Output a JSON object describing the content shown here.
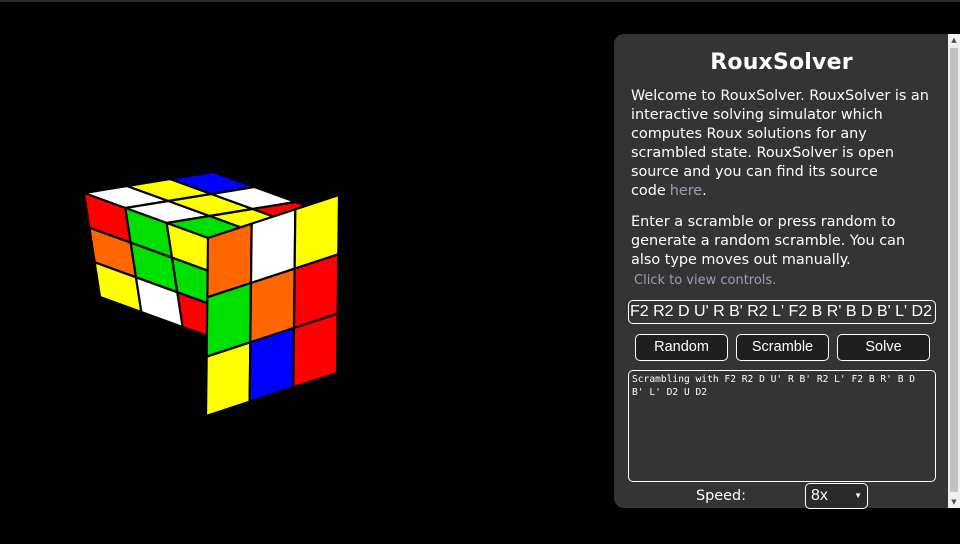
{
  "app": {
    "title": "RouxSolver"
  },
  "intro": {
    "text": "Welcome to RouxSolver. RouxSolver is an interactive solving simulator which computes Roux solutions for any scrambled state. RouxSolver is open source and you can find its source code",
    "link_label": "here",
    "after_link": "."
  },
  "instructions": {
    "text": "Enter a scramble or press random to generate a random scramble. You can also type moves out manually.",
    "controls_link": "Click to view controls."
  },
  "scramble": {
    "value": "F2 R2 D U' R B' R2 L' F2 B R' B D B' L' D2 U D2"
  },
  "buttons": {
    "random": "Random",
    "scramble": "Scramble",
    "solve": "Solve"
  },
  "log": {
    "text": "Scrambling with F2 R2 D U' R B' R2 L' F2 B R' B D B' L' D2 U D2"
  },
  "speed": {
    "label": "Speed:",
    "selected": "8x",
    "icon": "chevron-down-icon"
  },
  "cube": {
    "colors": {
      "white": "#ffffff",
      "yellow": "#ffff00",
      "red": "#ff0000",
      "orange": "#ff6600",
      "green": "#00e000",
      "blue": "#0000ff"
    },
    "top": [
      [
        "white",
        "yellow",
        "blue"
      ],
      [
        "white",
        "yellow",
        "white"
      ],
      [
        "green",
        "yellow",
        "red"
      ]
    ],
    "left": [
      [
        "red",
        "green",
        "yellow"
      ],
      [
        "orange",
        "green",
        "green"
      ],
      [
        "yellow",
        "white",
        "red"
      ]
    ],
    "right": [
      [
        "orange",
        "white",
        "yellow"
      ],
      [
        "green",
        "orange",
        "red"
      ],
      [
        "yellow",
        "blue",
        "red"
      ]
    ]
  }
}
